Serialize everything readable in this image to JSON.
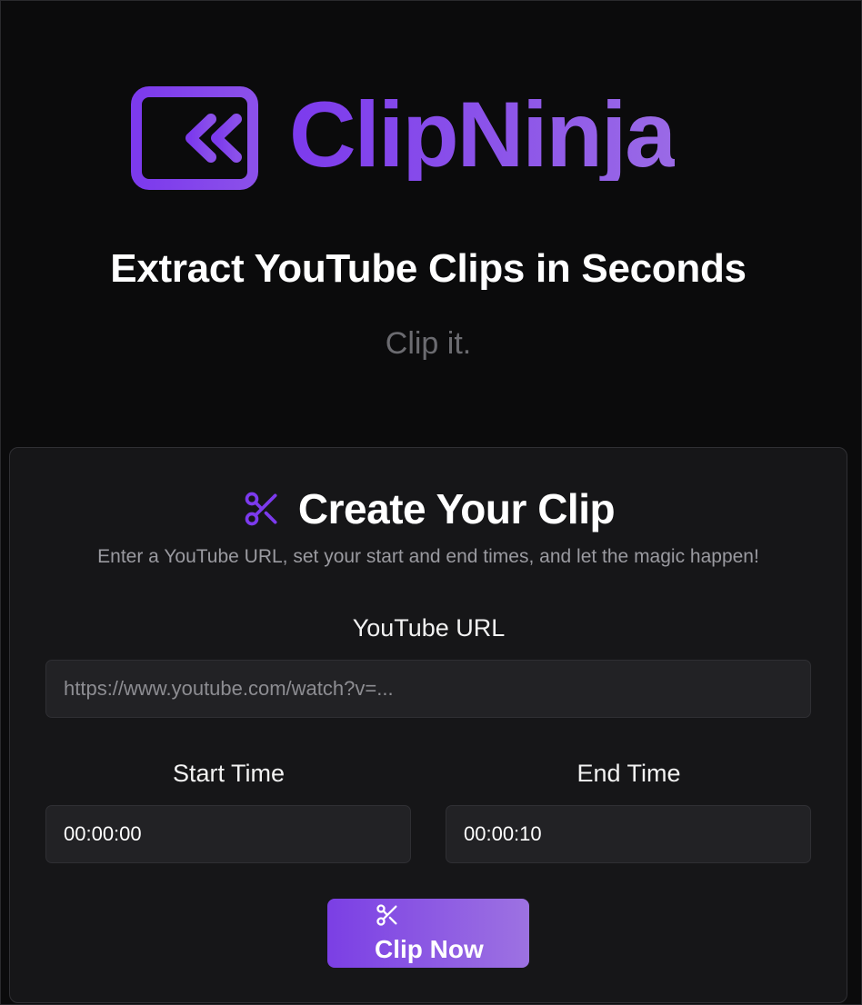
{
  "brand": {
    "name": "ClipNinja",
    "logo_icon": "rewind-double-chevron-icon",
    "accent_color": "#7c3aed",
    "accent_light": "#9a6ae6"
  },
  "hero": {
    "headline": "Extract YouTube Clips in Seconds",
    "tagline": "Clip it."
  },
  "form": {
    "title": "Create Your Clip",
    "title_icon": "scissors-icon",
    "subtitle": "Enter a YouTube URL, set your start and end times, and let the magic happen!",
    "url_label": "YouTube URL",
    "url_placeholder": "https://www.youtube.com/watch?v=...",
    "url_value": "",
    "start_label": "Start Time",
    "start_value": "00:00:00",
    "end_label": "End Time",
    "end_value": "00:00:10",
    "submit_label": "Clip Now",
    "submit_icon": "scissors-icon"
  }
}
